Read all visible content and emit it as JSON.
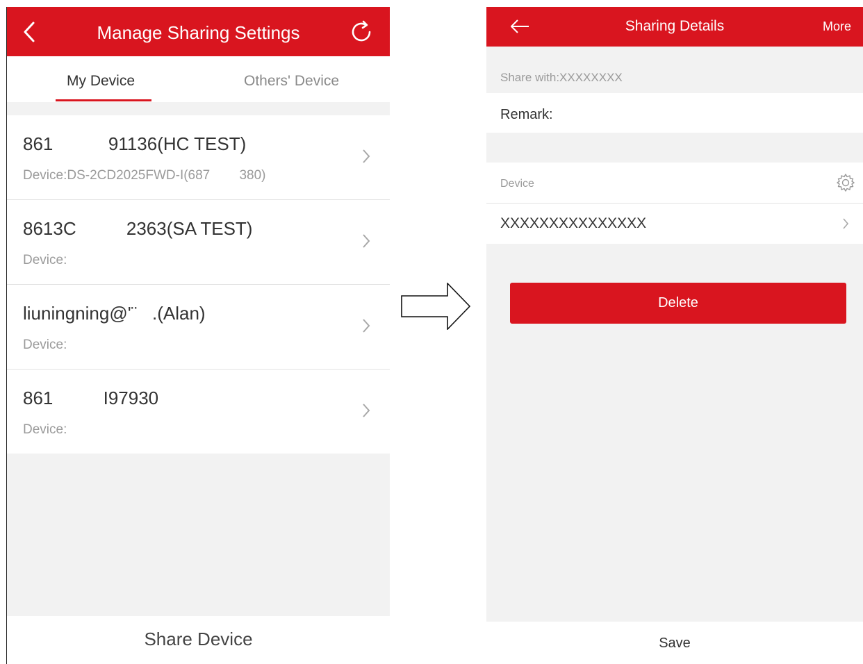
{
  "left": {
    "title": "Manage Sharing Settings",
    "tabs": [
      {
        "label": "My Device"
      },
      {
        "label": "Others' Device"
      }
    ],
    "items": [
      {
        "primary": "861           91136(HC TEST)",
        "secondary": "Device:DS-2CD2025FWD-I(687        380)"
      },
      {
        "primary": "8613C          2363(SA TEST)",
        "secondary": "Device:"
      },
      {
        "primary": "liuningning@'¨   .(Alan)",
        "secondary": "Device:"
      },
      {
        "primary": "861          I97930",
        "secondary": "Device:"
      }
    ],
    "bottom_label": "Share Device"
  },
  "right": {
    "title": "Sharing Details",
    "more_label": "More",
    "share_with": "Share with:XXXXXXXX",
    "remark_label": "Remark:",
    "device_header": "Device",
    "device_name": "XXXXXXXXXXXXXXX",
    "delete_label": "Delete",
    "save_label": "Save"
  },
  "colors": {
    "brand_red": "#d9151f",
    "background": "#f2f2f2"
  },
  "icons": [
    "back-chevron-icon",
    "refresh-icon",
    "back-arrow-icon",
    "chevron-right-icon",
    "gear-icon",
    "flow-arrow-icon"
  ]
}
